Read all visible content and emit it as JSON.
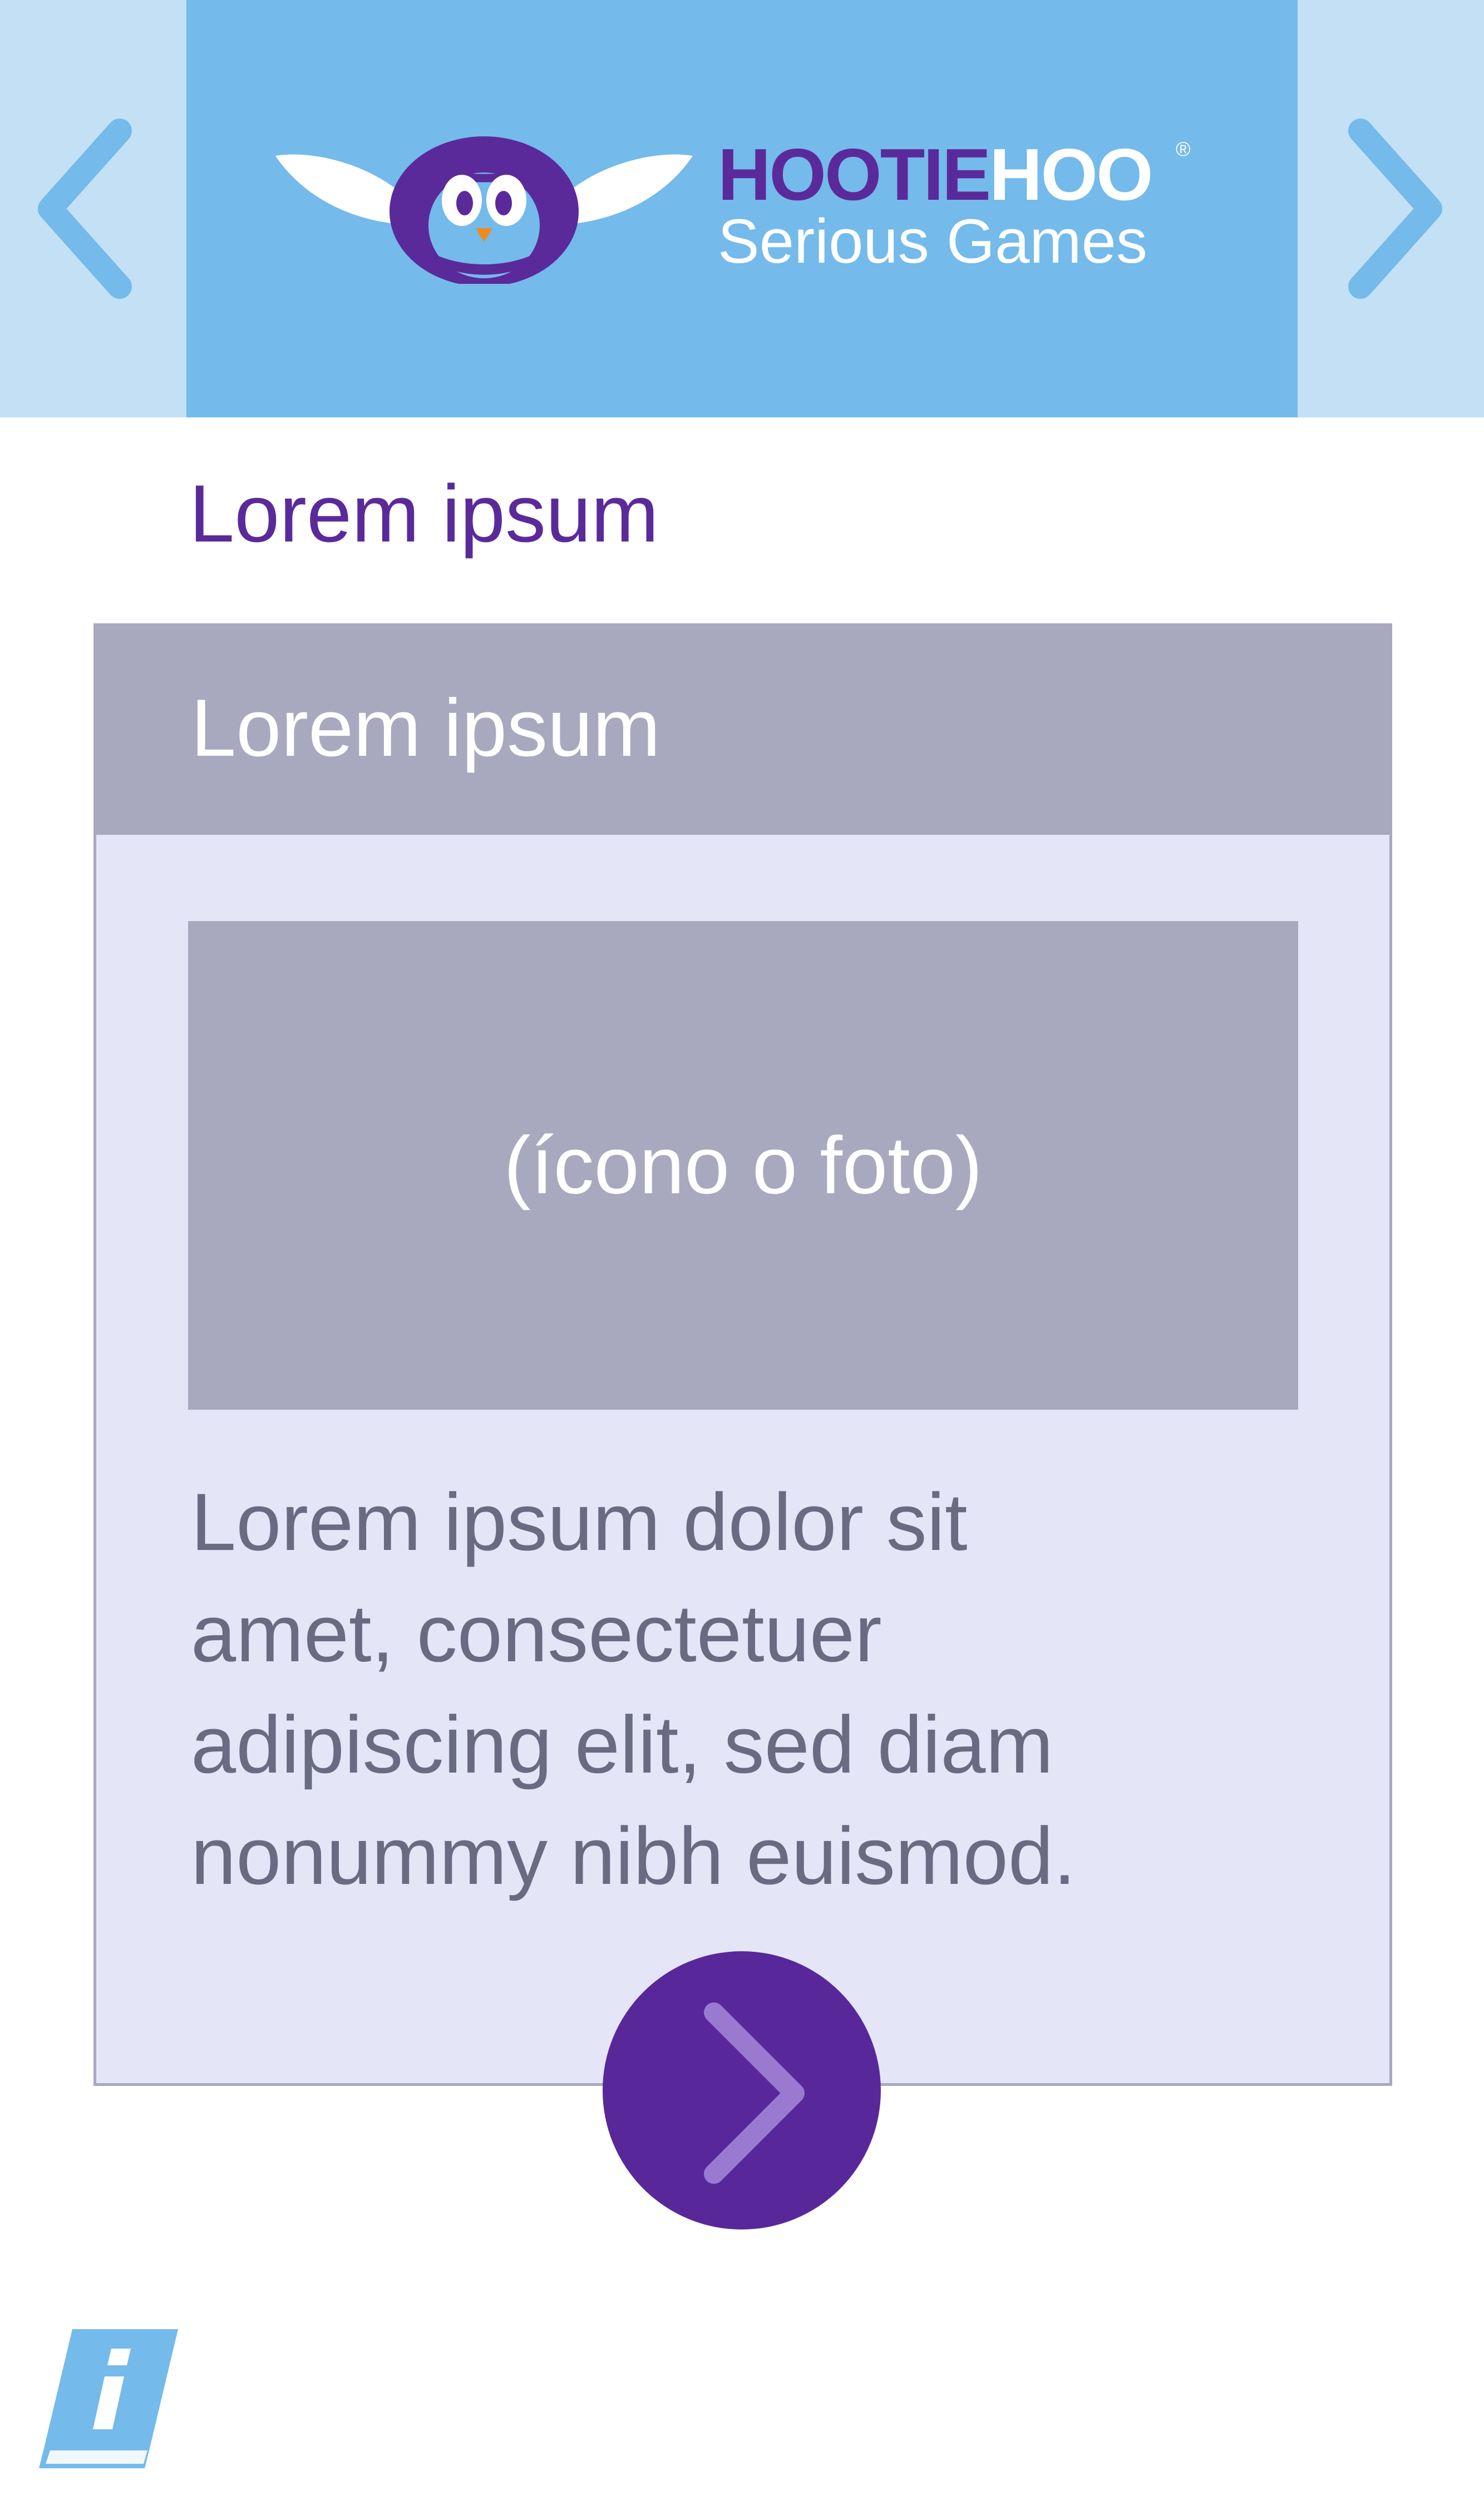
{
  "header": {
    "prev_icon": "chevron-left-icon",
    "next_icon": "chevron-right-icon",
    "logo": {
      "icon": "owl-icon",
      "brand_part1": "HOOTIE",
      "brand_part2": "HOO",
      "registered_mark": "®",
      "tagline": "Serious Games"
    }
  },
  "page": {
    "title": "Lorem ipsum"
  },
  "card": {
    "title": "Lorem ipsum",
    "media_label": "(ícono o foto)",
    "body_lines": [
      "Lorem ipsum dolor sit",
      "amet, consectetuer",
      "adipiscing elit, sed diam",
      "nonummy nibh euismod."
    ],
    "next_button_icon": "chevron-right-icon"
  },
  "footer": {
    "info_icon": "info-book-icon"
  },
  "colors": {
    "header_bg": "#74baeb",
    "header_side_bg": "#c3e0f5",
    "brand_purple": "#5b2a9a",
    "card_bg": "#e4e6f8",
    "card_header_bg": "#a8a9be",
    "body_text": "#6a6b82",
    "button_purple": "#58289a"
  }
}
